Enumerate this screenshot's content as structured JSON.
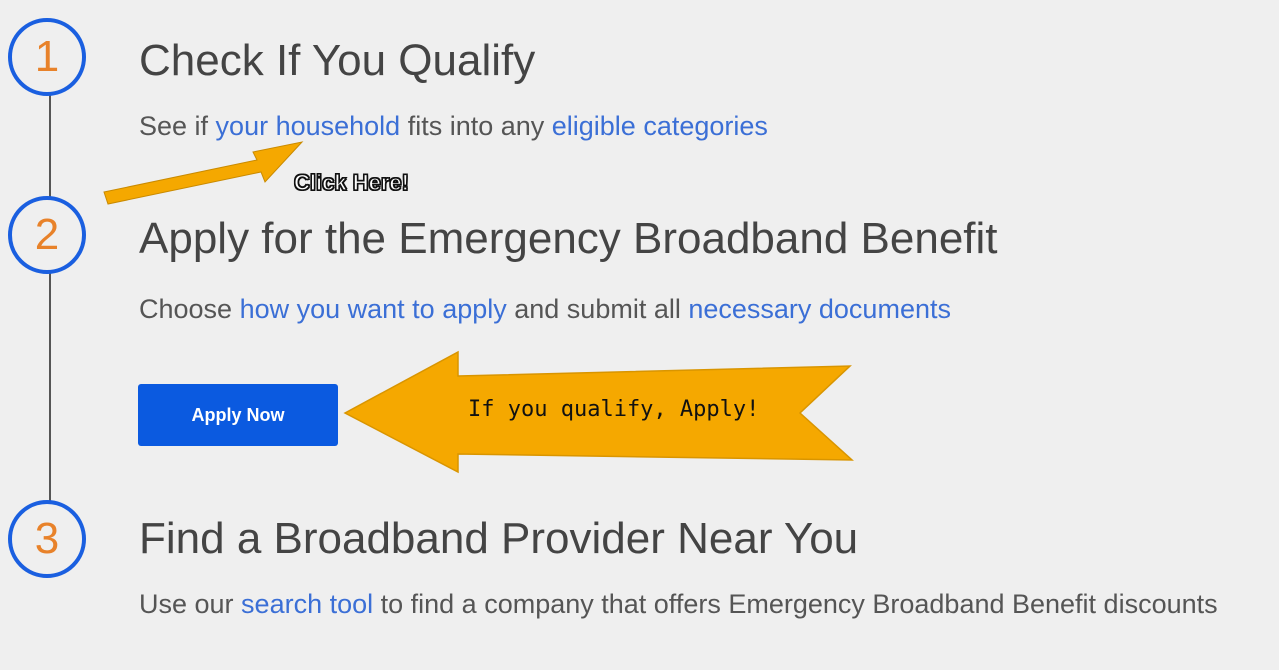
{
  "steps": [
    {
      "number": "1",
      "title": "Check If You Qualify",
      "desc_before": "See if ",
      "link1": "your household",
      "desc_middle": " fits into any ",
      "link2": "eligible categories"
    },
    {
      "number": "2",
      "title": "Apply for the Emergency Broadband Benefit",
      "desc_before": "Choose ",
      "link1": "how you want to apply",
      "desc_middle": " and submit all ",
      "link2": "necessary documents",
      "button_label": "Apply Now"
    },
    {
      "number": "3",
      "title": "Find a Broadband Provider Near You",
      "desc_before": "Use our ",
      "link1": "search tool",
      "desc_after": " to find a company that offers Emergency Broadband Benefit discounts"
    }
  ],
  "annotations": {
    "click_here": "Click Here!",
    "banner_text": "If you qualify, Apply!"
  },
  "colors": {
    "background": "#efefef",
    "circle_border": "#1a5fe0",
    "step_number": "#e8822a",
    "link": "#3b6fd6",
    "button": "#0b5ae0",
    "annotation_arrow": "#f5a800"
  }
}
